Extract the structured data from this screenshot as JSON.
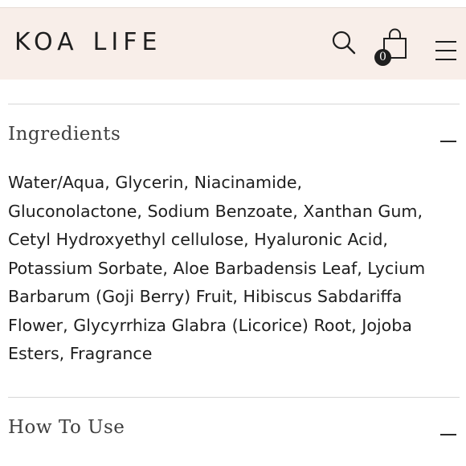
{
  "header": {
    "brand_a": "KOA",
    "brand_b": "LIFE",
    "cart_count": "0"
  },
  "accordion": {
    "ingredients_title": "Ingredients",
    "ingredients_lines": [
      "Water/Aqua, Glycerin, Niacinamide,",
      "Gluconolactone, Sodium Benzoate, Xanthan Gum,",
      "Cetyl Hydroxyethyl cellulose, Hyaluronic Acid,",
      "Potassium Sorbate, Aloe Barbadensis Leaf, Lycium",
      "Barbarum (Goji Berry) Fruit, Hibiscus Sabdariffa",
      "Flower, Glycyrrhiza Glabra (Licorice) Root, Jojoba",
      "Esters, Fragrance"
    ],
    "howto_title": "How To Use"
  },
  "icons": {
    "search": "search-icon",
    "cart": "shopping-bag-icon",
    "menu": "hamburger-menu-icon",
    "collapse": "minus-icon"
  },
  "colors": {
    "header_bg": "#f8eee9",
    "text": "#1e1e1e",
    "divider": "#d6d6d6"
  }
}
